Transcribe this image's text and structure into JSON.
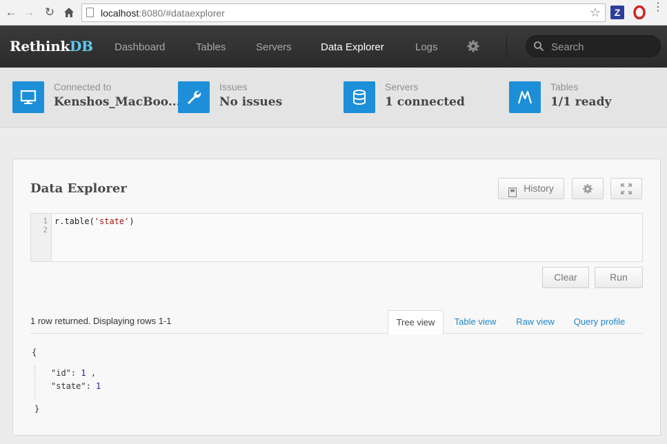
{
  "browser": {
    "url_host": "localhost",
    "url_rest": ":8080/#dataexplorer"
  },
  "nav": {
    "logo_prefix": "Rethink",
    "logo_suffix": "DB",
    "links": [
      "Dashboard",
      "Tables",
      "Servers",
      "Data Explorer",
      "Logs"
    ],
    "active": "Data Explorer",
    "search_placeholder": "Search"
  },
  "status": {
    "connected": {
      "label": "Connected to",
      "value": "Kenshos_MacBoo..."
    },
    "issues": {
      "label": "Issues",
      "value": "No issues"
    },
    "servers": {
      "label": "Servers",
      "value": "1 connected"
    },
    "tables": {
      "label": "Tables",
      "value": "1/1 ready"
    }
  },
  "explorer": {
    "title": "Data Explorer",
    "history_label": "History",
    "line_numbers": [
      "1",
      "2"
    ],
    "code_prefix": "r.table(",
    "code_string": "'state'",
    "code_suffix": ")",
    "clear_label": "Clear",
    "run_label": "Run",
    "rows_info": "1 row returned. Displaying rows 1-1",
    "tabs": [
      "Tree view",
      "Table view",
      "Raw view",
      "Query profile"
    ],
    "active_tab": "Tree view",
    "result": {
      "open": "{",
      "close": "}",
      "fields": [
        {
          "key": "\"id\"",
          "value": "1",
          "trail": " ,"
        },
        {
          "key": "\"state\"",
          "value": "1",
          "trail": ""
        }
      ]
    }
  },
  "colors": {
    "accent": "#1c8fd8",
    "link": "#1f86c9",
    "topbar": "#2f2f2f",
    "logo_db": "#5ec8f0"
  }
}
